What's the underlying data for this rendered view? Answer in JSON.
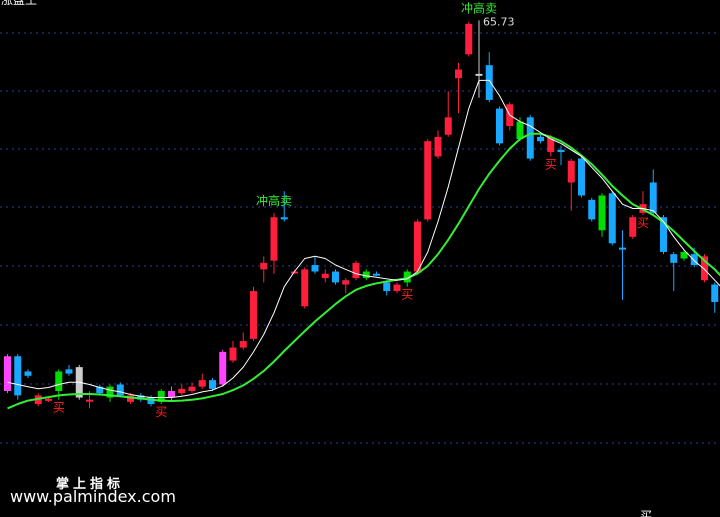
{
  "app": {
    "top_label": "涨盘王",
    "brand": "掌上指标",
    "website": "www.palmindex.com",
    "bottom_label": "买"
  },
  "chart_data": {
    "type": "candlestick",
    "title": "",
    "xlabel": "",
    "ylabel": "",
    "ylim": [
      54.3,
      66.2
    ],
    "grid": "dashed horizontal",
    "colors": {
      "background": "#000000",
      "up": "#ff1f3c",
      "down": "#18a8ff",
      "signal_up": "#00dd00",
      "signal_alt": "#ff44ff",
      "doji": "#cccccc",
      "ma_fast": "#ffffff",
      "ma_slow": "#33ee33",
      "buy_text": "#ff2222",
      "sell_text": "#33ee33",
      "grid": "#2b3fa0"
    },
    "candles": [
      {
        "o": 57.2,
        "c": 58.0,
        "h": 58.05,
        "l": 57.15,
        "k": "alt"
      },
      {
        "o": 58.0,
        "c": 57.1,
        "h": 58.05,
        "l": 57.0,
        "k": "down"
      },
      {
        "o": 57.65,
        "c": 57.55,
        "h": 57.7,
        "l": 57.5,
        "k": "down"
      },
      {
        "o": 56.9,
        "c": 57.1,
        "h": 57.15,
        "l": 56.85,
        "k": "up"
      },
      {
        "o": 56.98,
        "c": 57.02,
        "h": 57.05,
        "l": 56.95,
        "k": "up"
      },
      {
        "o": 57.2,
        "c": 57.65,
        "h": 57.7,
        "l": 57.0,
        "k": "signal"
      },
      {
        "o": 57.6,
        "c": 57.7,
        "h": 57.8,
        "l": 57.55,
        "k": "down"
      },
      {
        "o": 57.75,
        "c": 57.05,
        "h": 57.8,
        "l": 57.0,
        "k": "doji"
      },
      {
        "o": 57.0,
        "c": 57.0,
        "h": 57.2,
        "l": 56.8,
        "k": "up"
      },
      {
        "o": 57.15,
        "c": 57.3,
        "h": 57.35,
        "l": 57.1,
        "k": "down"
      },
      {
        "o": 57.05,
        "c": 57.3,
        "h": 57.35,
        "l": 56.95,
        "k": "signal"
      },
      {
        "o": 57.35,
        "c": 57.1,
        "h": 57.4,
        "l": 57.05,
        "k": "down"
      },
      {
        "o": 56.95,
        "c": 57.1,
        "h": 57.15,
        "l": 56.9,
        "k": "up"
      },
      {
        "o": 57.1,
        "c": 57.0,
        "h": 57.15,
        "l": 56.95,
        "k": "down"
      },
      {
        "o": 56.9,
        "c": 57.05,
        "h": 57.1,
        "l": 56.85,
        "k": "down"
      },
      {
        "o": 57.2,
        "c": 56.95,
        "h": 57.25,
        "l": 56.9,
        "k": "signal"
      },
      {
        "o": 57.05,
        "c": 57.2,
        "h": 57.3,
        "l": 56.95,
        "k": "alt"
      },
      {
        "o": 57.15,
        "c": 57.25,
        "h": 57.35,
        "l": 57.1,
        "k": "up"
      },
      {
        "o": 57.2,
        "c": 57.3,
        "h": 57.4,
        "l": 57.15,
        "k": "up"
      },
      {
        "o": 57.3,
        "c": 57.45,
        "h": 57.6,
        "l": 57.25,
        "k": "up"
      },
      {
        "o": 57.45,
        "c": 57.25,
        "h": 57.5,
        "l": 57.2,
        "k": "down"
      },
      {
        "o": 57.35,
        "c": 58.1,
        "h": 58.15,
        "l": 57.3,
        "k": "alt"
      },
      {
        "o": 57.9,
        "c": 58.2,
        "h": 58.35,
        "l": 57.85,
        "k": "up"
      },
      {
        "o": 58.2,
        "c": 58.35,
        "h": 58.55,
        "l": 58.15,
        "k": "up"
      },
      {
        "o": 58.4,
        "c": 59.5,
        "h": 59.6,
        "l": 58.35,
        "k": "up"
      },
      {
        "o": 60.0,
        "c": 60.15,
        "h": 60.3,
        "l": 59.7,
        "k": "up"
      },
      {
        "o": 60.2,
        "c": 61.2,
        "h": 61.3,
        "l": 59.9,
        "k": "up"
      },
      {
        "o": 61.2,
        "c": 61.15,
        "h": 61.8,
        "l": 61.1,
        "k": "down"
      },
      {
        "o": 59.95,
        "c": 59.95,
        "h": 59.98,
        "l": 59.92,
        "k": "up"
      },
      {
        "o": 60.0,
        "c": 59.15,
        "h": 60.05,
        "l": 59.1,
        "k": "up"
      },
      {
        "o": 60.1,
        "c": 59.95,
        "h": 60.3,
        "l": 59.9,
        "k": "down"
      },
      {
        "o": 59.8,
        "c": 59.9,
        "h": 60.0,
        "l": 59.7,
        "k": "up"
      },
      {
        "o": 59.95,
        "c": 59.7,
        "h": 60.0,
        "l": 59.65,
        "k": "down"
      },
      {
        "o": 59.65,
        "c": 59.75,
        "h": 59.8,
        "l": 59.45,
        "k": "up"
      },
      {
        "o": 59.8,
        "c": 60.15,
        "h": 60.2,
        "l": 59.75,
        "k": "up"
      },
      {
        "o": 59.95,
        "c": 59.8,
        "h": 60.0,
        "l": 59.75,
        "k": "signal"
      },
      {
        "o": 59.9,
        "c": 59.9,
        "h": 59.95,
        "l": 59.85,
        "k": "down"
      },
      {
        "o": 59.7,
        "c": 59.5,
        "h": 59.75,
        "l": 59.4,
        "k": "down"
      },
      {
        "o": 59.5,
        "c": 59.65,
        "h": 59.7,
        "l": 59.45,
        "k": "up"
      },
      {
        "o": 59.7,
        "c": 59.95,
        "h": 60.0,
        "l": 59.6,
        "k": "signal"
      },
      {
        "o": 59.95,
        "c": 61.1,
        "h": 61.15,
        "l": 59.9,
        "k": "up"
      },
      {
        "o": 61.15,
        "c": 62.95,
        "h": 63.0,
        "l": 61.1,
        "k": "up"
      },
      {
        "o": 62.6,
        "c": 63.05,
        "h": 63.2,
        "l": 62.55,
        "k": "up"
      },
      {
        "o": 63.1,
        "c": 63.5,
        "h": 64.1,
        "l": 63.05,
        "k": "up"
      },
      {
        "o": 64.4,
        "c": 64.6,
        "h": 64.75,
        "l": 63.6,
        "k": "up"
      },
      {
        "o": 64.95,
        "c": 65.65,
        "h": 65.7,
        "l": 64.9,
        "k": "up"
      },
      {
        "o": 64.5,
        "c": 64.5,
        "h": 65.73,
        "l": 63.95,
        "k": "doji"
      },
      {
        "o": 64.7,
        "c": 63.9,
        "h": 65.0,
        "l": 63.85,
        "k": "down"
      },
      {
        "o": 63.7,
        "c": 62.9,
        "h": 63.75,
        "l": 62.85,
        "k": "down"
      },
      {
        "o": 63.3,
        "c": 63.8,
        "h": 63.85,
        "l": 63.2,
        "k": "up"
      },
      {
        "o": 63.4,
        "c": 63.0,
        "h": 63.5,
        "l": 62.95,
        "k": "signal"
      },
      {
        "o": 63.5,
        "c": 62.55,
        "h": 63.55,
        "l": 62.5,
        "k": "down"
      },
      {
        "o": 62.95,
        "c": 63.05,
        "h": 63.1,
        "l": 62.9,
        "k": "down"
      },
      {
        "o": 63.05,
        "c": 62.7,
        "h": 63.1,
        "l": 62.6,
        "k": "up"
      },
      {
        "o": 62.75,
        "c": 62.7,
        "h": 62.85,
        "l": 62.4,
        "k": "down"
      },
      {
        "o": 62.5,
        "c": 62.0,
        "h": 62.55,
        "l": 61.35,
        "k": "up"
      },
      {
        "o": 62.55,
        "c": 61.7,
        "h": 62.6,
        "l": 61.65,
        "k": "down"
      },
      {
        "o": 61.6,
        "c": 61.15,
        "h": 61.65,
        "l": 61.1,
        "k": "down"
      },
      {
        "o": 61.7,
        "c": 60.9,
        "h": 61.75,
        "l": 60.75,
        "k": "signal"
      },
      {
        "o": 61.75,
        "c": 60.6,
        "h": 61.8,
        "l": 60.55,
        "k": "down"
      },
      {
        "o": 60.5,
        "c": 60.5,
        "h": 60.9,
        "l": 59.3,
        "k": "down"
      },
      {
        "o": 61.2,
        "c": 60.75,
        "h": 61.25,
        "l": 60.7,
        "k": "up"
      },
      {
        "o": 61.5,
        "c": 61.3,
        "h": 61.8,
        "l": 61.25,
        "k": "up"
      },
      {
        "o": 62.0,
        "c": 61.3,
        "h": 62.3,
        "l": 61.25,
        "k": "down"
      },
      {
        "o": 61.2,
        "c": 60.4,
        "h": 61.25,
        "l": 60.35,
        "k": "down"
      },
      {
        "o": 60.35,
        "c": 60.15,
        "h": 60.4,
        "l": 59.5,
        "k": "down"
      },
      {
        "o": 60.4,
        "c": 60.25,
        "h": 60.45,
        "l": 60.2,
        "k": "signal"
      },
      {
        "o": 60.35,
        "c": 60.1,
        "h": 60.5,
        "l": 60.05,
        "k": "down"
      },
      {
        "o": 60.3,
        "c": 59.75,
        "h": 60.35,
        "l": 59.7,
        "k": "up"
      },
      {
        "o": 59.65,
        "c": 59.25,
        "h": 59.7,
        "l": 59.0,
        "k": "down"
      },
      {
        "o": 59.65,
        "c": 59.3,
        "h": 59.7,
        "l": 59.25,
        "k": "down"
      }
    ],
    "ma_fast": [
      57.4,
      57.35,
      57.3,
      57.25,
      57.28,
      57.35,
      57.4,
      57.4,
      57.35,
      57.28,
      57.22,
      57.18,
      57.12,
      57.08,
      57.05,
      57.05,
      57.05,
      57.08,
      57.12,
      57.18,
      57.22,
      57.32,
      57.5,
      57.75,
      58.1,
      58.5,
      59.0,
      59.6,
      59.95,
      60.25,
      60.3,
      60.25,
      60.1,
      60.0,
      59.9,
      59.85,
      59.82,
      59.78,
      59.75,
      59.78,
      59.95,
      60.4,
      61.1,
      61.9,
      62.8,
      63.7,
      64.35,
      64.35,
      64.0,
      63.55,
      63.4,
      63.3,
      63.15,
      63.0,
      62.9,
      62.75,
      62.6,
      62.35,
      62.1,
      61.8,
      61.5,
      61.4,
      61.4,
      61.35,
      61.1,
      60.75,
      60.45,
      60.2,
      60.0,
      59.75,
      59.5
    ],
    "ma_slow": [
      56.8,
      56.9,
      56.98,
      57.02,
      57.06,
      57.1,
      57.12,
      57.13,
      57.13,
      57.12,
      57.1,
      57.08,
      57.05,
      57.03,
      57.0,
      56.98,
      56.97,
      56.98,
      57.0,
      57.03,
      57.08,
      57.13,
      57.22,
      57.33,
      57.48,
      57.66,
      57.88,
      58.12,
      58.35,
      58.58,
      58.8,
      59.0,
      59.2,
      59.38,
      59.53,
      59.62,
      59.68,
      59.72,
      59.76,
      59.8,
      59.9,
      60.08,
      60.35,
      60.68,
      61.05,
      61.45,
      61.85,
      62.2,
      62.5,
      62.78,
      63.0,
      63.12,
      63.12,
      63.05,
      62.95,
      62.8,
      62.62,
      62.42,
      62.18,
      61.92,
      61.7,
      61.5,
      61.38,
      61.25,
      61.08,
      60.88,
      60.65,
      60.42,
      60.2,
      60.0,
      59.75
    ],
    "signals": [
      {
        "i": 5,
        "text": "买",
        "kind": "buy"
      },
      {
        "i": 15,
        "text": "买",
        "kind": "buy"
      },
      {
        "i": 26,
        "text": "冲高卖",
        "kind": "sell"
      },
      {
        "i": 39,
        "text": "买",
        "kind": "buy"
      },
      {
        "i": 46,
        "text": "冲高卖",
        "kind": "sell"
      },
      {
        "i": 53,
        "text": "买",
        "kind": "buy"
      },
      {
        "i": 62,
        "text": "买",
        "kind": "buy"
      }
    ],
    "annotations": [
      {
        "i": 46,
        "text": "65.73"
      }
    ]
  }
}
